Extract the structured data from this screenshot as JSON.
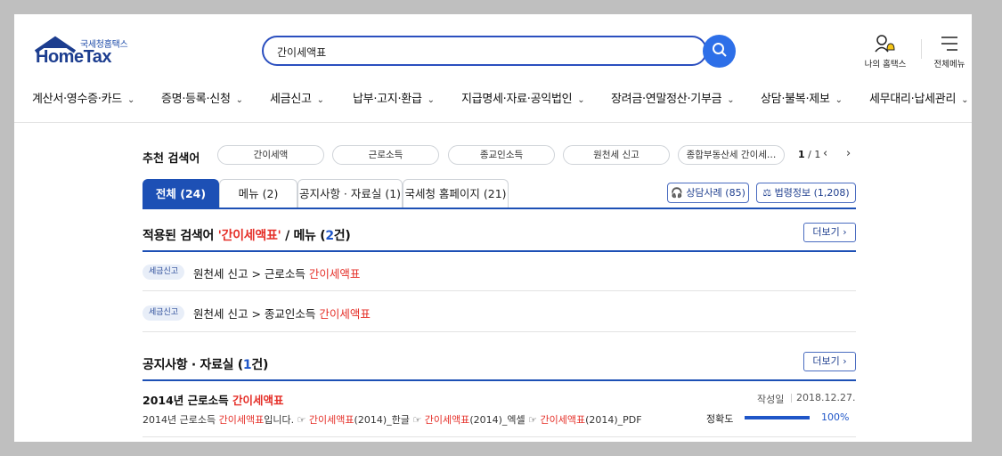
{
  "header": {
    "logo_kr": "국세청홈택스",
    "logo_en": "HomeTax",
    "search_value": "간이세액표",
    "util_my": "나의 홈택스",
    "util_menu": "전체메뉴"
  },
  "nav": [
    "계산서·영수증·카드",
    "증명·등록·신청",
    "세금신고",
    "납부·고지·환급",
    "지급명세·자료·공익법인",
    "장려금·연말정산·기부금",
    "상담·불복·제보",
    "세무대리·납세관리"
  ],
  "recommended": {
    "title": "추천 검색어",
    "chips": [
      "간이세액",
      "근로소득",
      "종교인소득",
      "원천세 신고",
      "종합부동산세 간이세…"
    ],
    "page": "1",
    "total": "/ 1"
  },
  "tabs": [
    "전체 (24)",
    "메뉴 (2)",
    "공지사항 · 자료실 (1)",
    "국세청 홈페이지 (21)"
  ],
  "extra_buttons": {
    "consult": "상담사례 (85)",
    "law": "법령정보 (1,208)"
  },
  "menu_section": {
    "prefix": "적용된 검색어 ",
    "keyword": "'간이세액표'",
    "middle": " / 메뉴 (",
    "count": "2",
    "suffix": "건)",
    "more": "더보기",
    "items": [
      {
        "badge": "세금신고",
        "path": "원천세 신고 > 근로소득 ",
        "hit": "간이세액표"
      },
      {
        "badge": "세금신고",
        "path": "원천세 신고 > 종교인소득 ",
        "hit": "간이세액표"
      }
    ]
  },
  "notice_section": {
    "prefix": "공지사항 · 자료실 (",
    "count": "1",
    "suffix": "건)",
    "more": "더보기",
    "item": {
      "title_pre": "2014년 근로소득 ",
      "title_hit": "간이세액표",
      "desc": [
        {
          "t": "2014년 근로소득 ",
          "hit": false
        },
        {
          "t": "간이세액표",
          "hit": true
        },
        {
          "t": "입니다. ☞ ",
          "hit": false
        },
        {
          "t": "간이세액표",
          "hit": true
        },
        {
          "t": "(2014)_한글 ☞ ",
          "hit": false
        },
        {
          "t": "간이세액표",
          "hit": true
        },
        {
          "t": "(2014)_엑셀 ☞ ",
          "hit": false
        },
        {
          "t": "간이세액표",
          "hit": true
        },
        {
          "t": "(2014)_PDF",
          "hit": false
        }
      ],
      "date_label": "작성일",
      "date": "2018.12.27.",
      "accuracy_label": "정확도",
      "accuracy": "100%",
      "accuracy_fraction": 1.0
    }
  },
  "colors": {
    "brand_blue": "#1d50b5",
    "highlight_red": "#e52f28",
    "search_blue": "#2d6fe8"
  }
}
